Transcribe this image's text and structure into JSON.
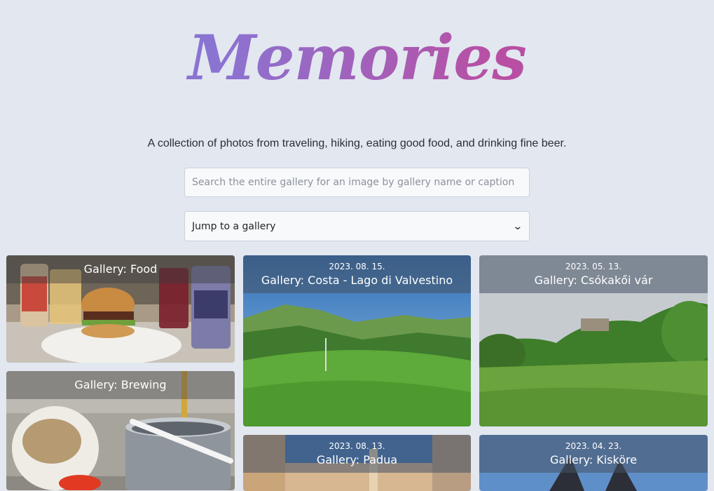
{
  "header": {
    "logo_text": "Memories",
    "tagline": "A collection of photos from traveling, hiking, eating good food, and drinking fine beer."
  },
  "search": {
    "placeholder": "Search the entire gallery for an image by gallery name or caption",
    "value": ""
  },
  "gallery_select": {
    "selected": "Jump to a gallery"
  },
  "galleries": [
    {
      "title": "Gallery: Food",
      "date": ""
    },
    {
      "title": "Gallery: Brewing",
      "date": ""
    },
    {
      "title": "Gallery: Costa - Lago di Valvestino",
      "date": "2023. 08. 15."
    },
    {
      "title": "Gallery: Padua",
      "date": "2023. 08. 13."
    },
    {
      "title": "Gallery: Csókakői vár",
      "date": "2023. 05. 13."
    },
    {
      "title": "Gallery: Kisköre",
      "date": "2023. 04. 23."
    }
  ],
  "colors": {
    "background": "#e2e7f0",
    "logo_gradient_start": "#8a74d2",
    "logo_gradient_end": "#b94fa3"
  }
}
